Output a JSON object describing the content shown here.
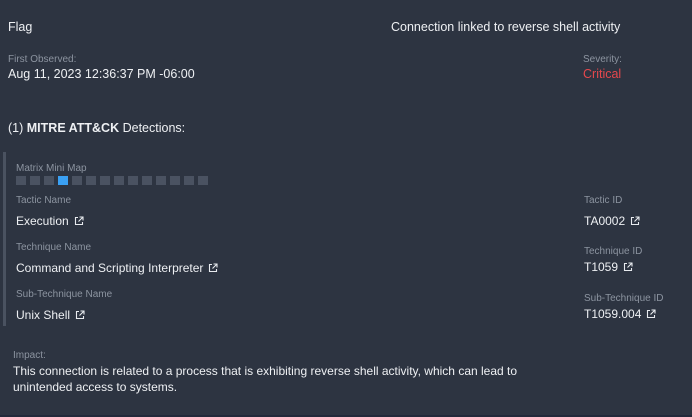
{
  "header": {
    "flag_label": "Flag",
    "alert_title": "Connection linked to reverse shell activity"
  },
  "observed": {
    "label": "First Observed:",
    "value": "Aug 11, 2023 12:36:37 PM -06:00"
  },
  "severity": {
    "label": "Severity:",
    "value": "Critical",
    "color": "#e5484d"
  },
  "mitre": {
    "count": "(1)",
    "name": "MITRE ATT&CK",
    "suffix": "Detections:"
  },
  "minimap": {
    "label": "Matrix Mini Map",
    "cells": 14,
    "active_index": 3,
    "active_color": "#3aa0f3"
  },
  "tactic": {
    "name_label": "Tactic Name",
    "name": "Execution",
    "id_label": "Tactic ID",
    "id": "TA0002"
  },
  "technique": {
    "name_label": "Technique Name",
    "name": "Command and Scripting Interpreter",
    "id_label": "Technique ID",
    "id": "T1059"
  },
  "subtechnique": {
    "name_label": "Sub-Technique Name",
    "name": "Unix Shell",
    "id_label": "Sub-Technique ID",
    "id": "T1059.004"
  },
  "impact": {
    "label": "Impact:",
    "text": "This connection is related to a process that is exhibiting reverse shell activity, which can lead to unintended access to systems."
  },
  "icons": {
    "external_link": "external-link-icon"
  }
}
